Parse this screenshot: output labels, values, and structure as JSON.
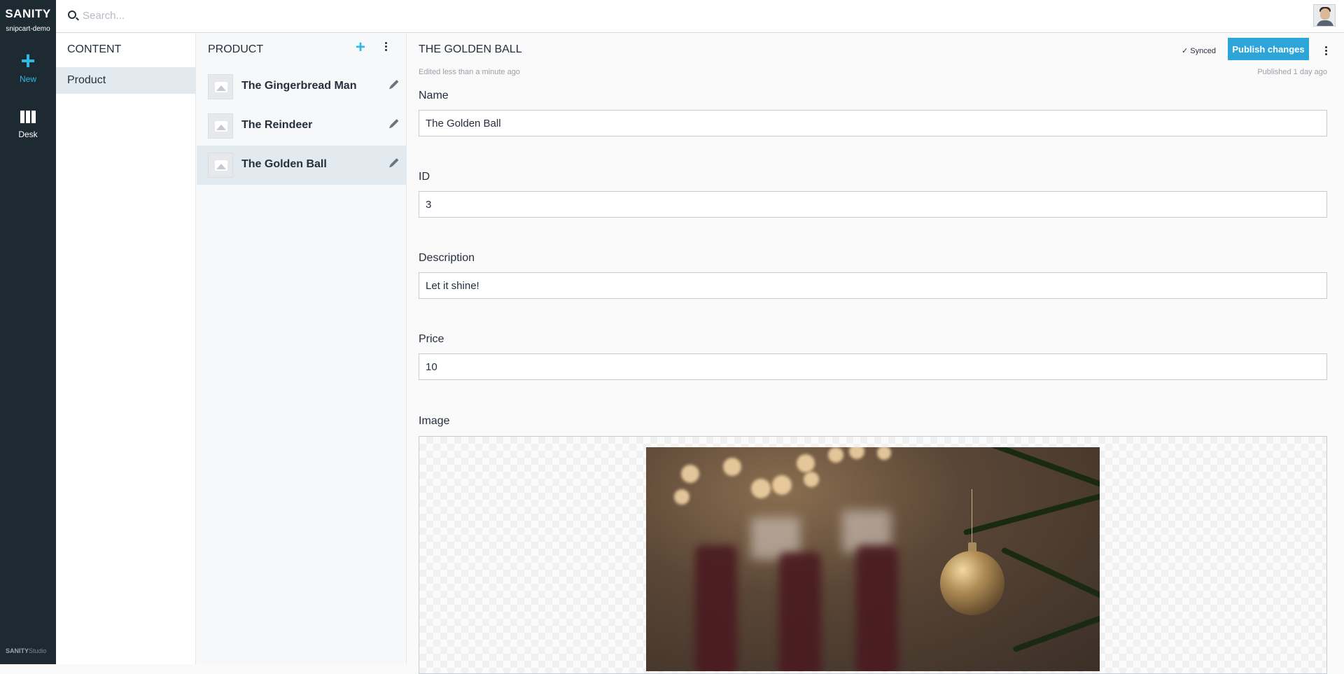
{
  "brand": {
    "name": "SANITY",
    "project": "snipcart-demo"
  },
  "nav": {
    "new_label": "New",
    "desk_label": "Desk"
  },
  "studio_mark": {
    "bold": "SANITY",
    "rest": "Studio"
  },
  "search": {
    "placeholder": "Search..."
  },
  "content_pane": {
    "title": "CONTENT",
    "items": [
      {
        "label": "Product"
      }
    ]
  },
  "list_pane": {
    "title": "PRODUCT",
    "items": [
      {
        "label": "The Gingerbread Man"
      },
      {
        "label": "The Reindeer"
      },
      {
        "label": "The Golden Ball"
      }
    ]
  },
  "editor": {
    "title": "THE GOLDEN BALL",
    "edited": "Edited less than a minute ago",
    "synced": "✓ Synced",
    "publish_label": "Publish changes",
    "published": "Published 1 day ago",
    "fields": {
      "name": {
        "label": "Name",
        "value": "The Golden Ball"
      },
      "id": {
        "label": "ID",
        "value": "3"
      },
      "description": {
        "label": "Description",
        "value": "Let it shine!"
      },
      "price": {
        "label": "Price",
        "value": "10"
      },
      "image": {
        "label": "Image"
      }
    }
  },
  "colors": {
    "sidebar": "#1e2a32",
    "accent": "#2eb8e6",
    "publish": "#2ea5d9",
    "selected": "#e2e9ef"
  }
}
